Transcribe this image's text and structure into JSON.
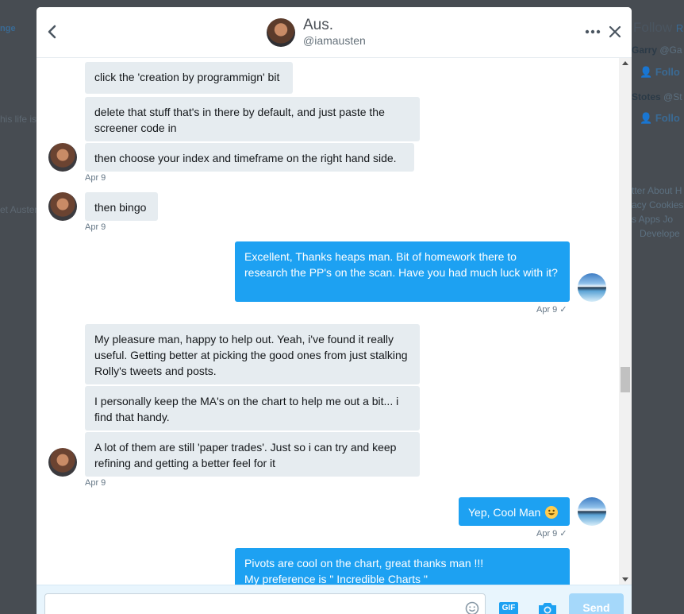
{
  "background": {
    "left_fragment_1": "nge",
    "left_fragment_2": "his life is",
    "left_fragment_3": "et Austen",
    "right_follow_header": "Follow",
    "right_follow_header_suffix": "R",
    "right_user1_name": "Garry",
    "right_user1_handle": "@Ga",
    "right_user1_follow": "Follo",
    "right_user2_name": "Stotes",
    "right_user2_handle": "@St",
    "right_user2_follow": "Follo",
    "footer_row1": "tter  About  H",
    "footer_row2": "acy  Cookies",
    "footer_row3": "s  Apps  Jo",
    "footer_row4": "Develope"
  },
  "header": {
    "name": "Aus.",
    "handle": "@iamausten"
  },
  "messages": [
    {
      "side": "received",
      "text": "click the 'creation by programmign' bit"
    },
    {
      "side": "received",
      "text": "delete that stuff that's in there by default, and just paste the screener code in"
    },
    {
      "side": "received",
      "text": "then choose your index and timeframe on the right hand side.",
      "time": "Apr 9"
    },
    {
      "side": "received",
      "text": "then bingo",
      "time": "Apr 9"
    },
    {
      "side": "sent",
      "text": "Excellent, Thanks heaps man. Bit of homework there to research the PP's on the scan. Have you had much luck with it?",
      "time": "Apr 9",
      "check": "✓"
    },
    {
      "side": "received",
      "text": "My pleasure man, happy to help out. Yeah, i've found it really useful. Getting better at picking the good ones from just stalking Rolly's tweets and posts."
    },
    {
      "side": "received",
      "text": "I personally keep the MA's on the chart to help me out a bit... i find that handy."
    },
    {
      "side": "received",
      "text": "A lot of them are still 'paper trades'. Just so i can try and keep refining and getting a better feel for it",
      "time": "Apr 9"
    },
    {
      "side": "sent",
      "text": "Yep, Cool Man",
      "time": "Apr 9",
      "check": "✓"
    },
    {
      "side": "sent",
      "lines": [
        "Pivots are cool on the chart, great thanks man !!!",
        "My preference is \" Incredible Charts \""
      ]
    }
  ],
  "composer": {
    "placeholder": "",
    "gif_label": "GIF",
    "send_label": "Send"
  },
  "colors": {
    "sent_bubble": "#1da1f2",
    "received_bubble": "#e6ecf0",
    "overlay": "#474c52"
  }
}
